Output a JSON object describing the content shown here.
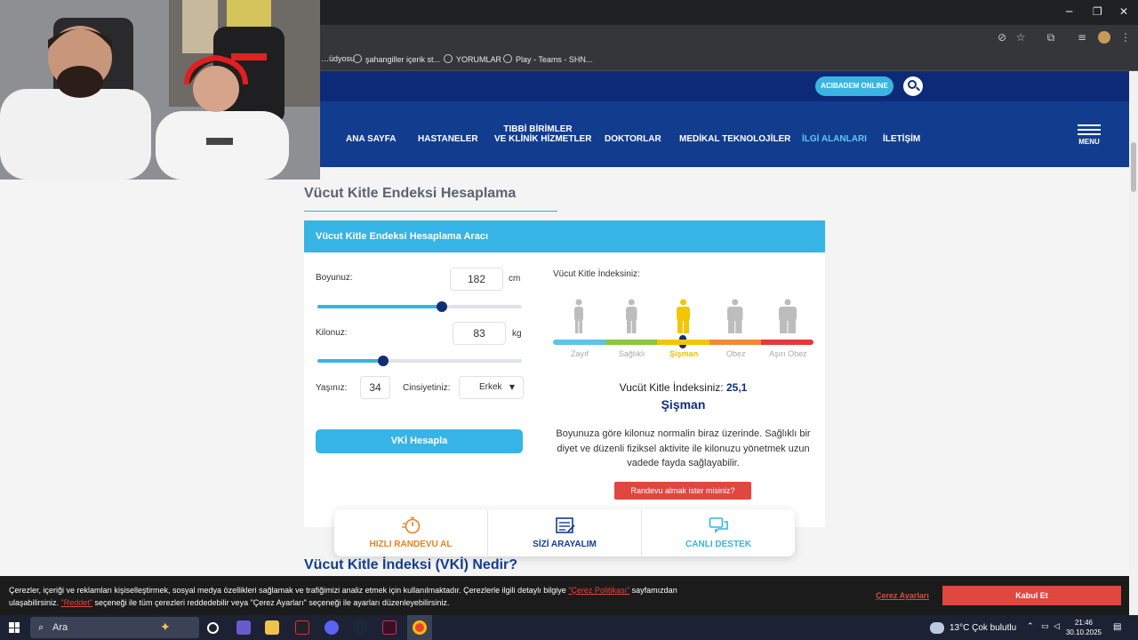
{
  "browser": {
    "bookmarks": [
      "…üdyosu",
      "şahangiller içerik st...",
      "YORUMLAR",
      "Play - Teams - SHN..."
    ]
  },
  "header": {
    "online_label": "ACIBADEM ONLINE",
    "nav": [
      "ANA SAYFA",
      "HASTANELER",
      "TIBBİ BİRİMLER",
      "VE KLİNİK HİZMETLER",
      "DOKTORLAR",
      "MEDİKAL TEKNOLOJİLER",
      "İLGİ ALANLARI",
      "İLETİŞİM"
    ],
    "menu_label": "MENU"
  },
  "page": {
    "title": "Vücut Kitle Endeksi Hesaplama",
    "card_title": "Vücut Kitle Endeksi Hesaplama Aracı",
    "height_label": "Boyunuz:",
    "height_value": "182",
    "height_unit": "cm",
    "height_slider": 0.61,
    "weight_label": "Kilonuz:",
    "weight_value": "83",
    "weight_unit": "kg",
    "weight_slider": 0.32,
    "age_label": "Yaşınız:",
    "age_value": "34",
    "gender_label": "Cinsiyetiniz:",
    "gender_value": "Erkek",
    "calc_button": "VKİ Hesapla",
    "bmi_title": "Vücut Kitle İndeksiniz:",
    "scale": [
      {
        "label": "Zayıf",
        "color": "#5bc4e8"
      },
      {
        "label": "Sağlıklı",
        "color": "#8cc63f"
      },
      {
        "label": "Şişman",
        "color": "#f2c600"
      },
      {
        "label": "Obez",
        "color": "#f08a3a"
      },
      {
        "label": "Aşırı Obez",
        "color": "#e53935"
      }
    ],
    "current_index": 2,
    "result_prefix": "Vucüt Kitle İndeksiniz:",
    "result_value": "25,1",
    "result_class": "Şişman",
    "result_desc": "Boyunuza göre kilonuz normalin biraz üzerinde. Sağlıklı bir diyet ve düzenli fiziksel aktivite ile kilonuzu yönetmek uzun vadede fayda sağlayabilir.",
    "appointment_button": "Randevu almak ister misiniz?",
    "section_heading": "Vücut Kitle İndeksi (VKİ) Nedir?"
  },
  "quick_actions": [
    {
      "label": "HIZLI RANDEVU AL",
      "color": "#e8821e",
      "icon": "stopwatch-icon"
    },
    {
      "label": "SİZİ ARAYALIM",
      "color": "#123d8f",
      "icon": "form-icon"
    },
    {
      "label": "CANLI DESTEK",
      "color": "#36b4e5",
      "icon": "chat-icon"
    }
  ],
  "cookie": {
    "text_1": "Çerezler, içeriği ve reklamları kişiselleştirmek, sosyal medya özellikleri sağlamak ve trafiğimizi analiz etmek için kullanılmaktadır. Çerezlerle ilgili detaylı bilgiye",
    "policy_link": "\"Çerez Politikası\"",
    "text_2": "sayfamızdan",
    "text_3": "ulaşabilirsiniz.",
    "reject_link": "\"Reddet\"",
    "text_4": "seçeneği ile tüm çerezleri reddedebilir veya \"Çerez Ayarları\" seçeneği ile ayarları düzenleyebilirsiniz.",
    "settings_link": "Çerez Ayarları",
    "accept_button": "Kabul Et"
  },
  "taskbar": {
    "search_placeholder": "Ara",
    "weather": "13°C  Çok bulutlu",
    "time": "21:46",
    "date": "30.10.2025"
  }
}
